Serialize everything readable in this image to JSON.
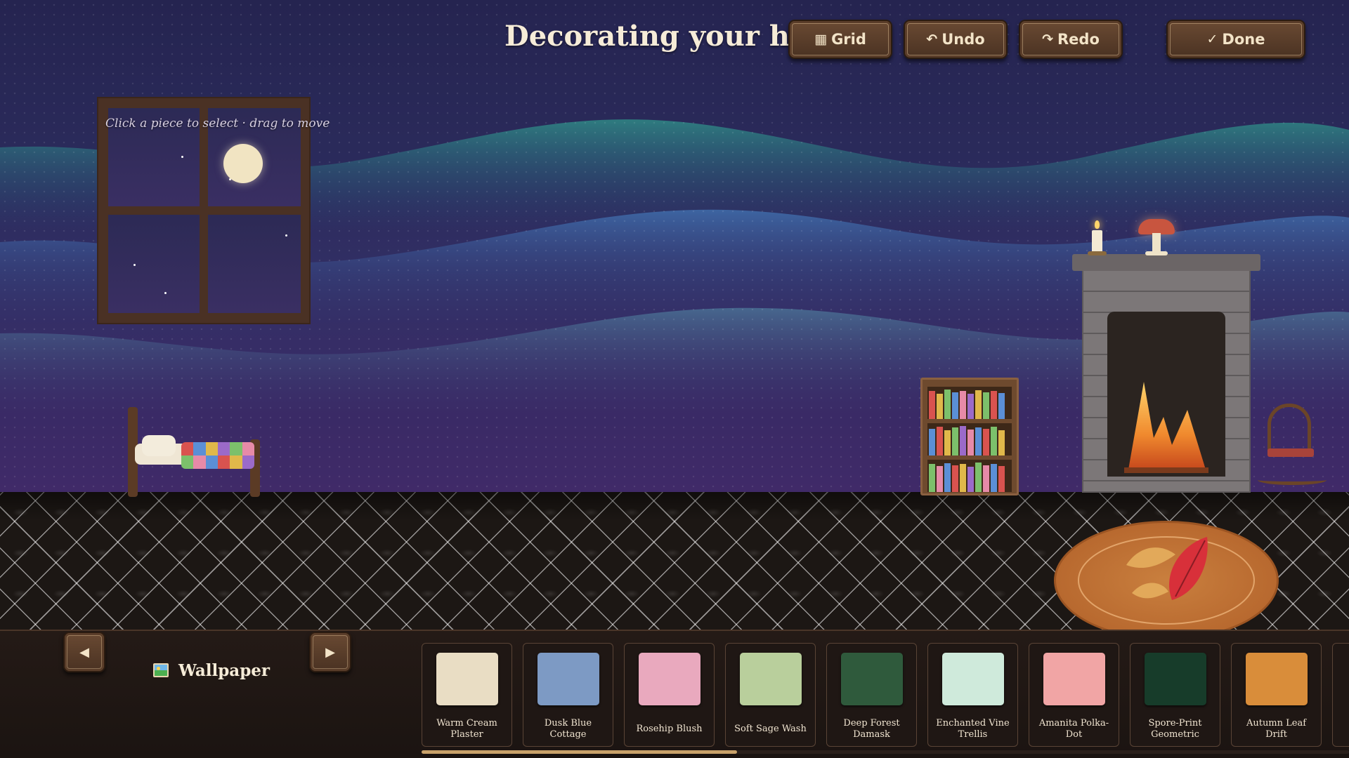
{
  "header": {
    "title": "Decorating your home",
    "grid_label": "Grid",
    "undo_label": "Undo",
    "redo_label": "Redo",
    "done_label": "Done",
    "grid_icon": "grid-icon",
    "undo_icon": "undo-icon",
    "redo_icon": "redo-icon",
    "done_icon": "check-icon"
  },
  "room": {
    "hint": "Click a piece to select · drag to move",
    "furniture": [
      "window",
      "bed",
      "bookcase",
      "fireplace",
      "candle",
      "mushroom-lamp",
      "rocking-chair",
      "leaf-rug"
    ]
  },
  "catalog": {
    "category_label": "Wallpaper",
    "category_icon": "picture-icon",
    "prev_icon": "arrow-left-icon",
    "next_icon": "arrow-right-icon",
    "items": [
      {
        "label": "Warm Cream Plaster",
        "color": "#e9ddc4"
      },
      {
        "label": "Dusk Blue Cottage",
        "color": "#7d9ac4"
      },
      {
        "label": "Rosehip Blush",
        "color": "#e9a9be"
      },
      {
        "label": "Soft Sage Wash",
        "color": "#b9cf9c"
      },
      {
        "label": "Deep Forest Damask",
        "color": "#2f5a3c"
      },
      {
        "label": "Enchanted Vine Trellis",
        "color": "#cfeadb"
      },
      {
        "label": "Amanita Polka-Dot",
        "color": "#f1a5a5"
      },
      {
        "label": "Spore-Print Geometric",
        "color": "#173c2a"
      },
      {
        "label": "Autumn Leaf Drift",
        "color": "#d98d3a"
      }
    ],
    "scroll_fraction": 0.34
  }
}
